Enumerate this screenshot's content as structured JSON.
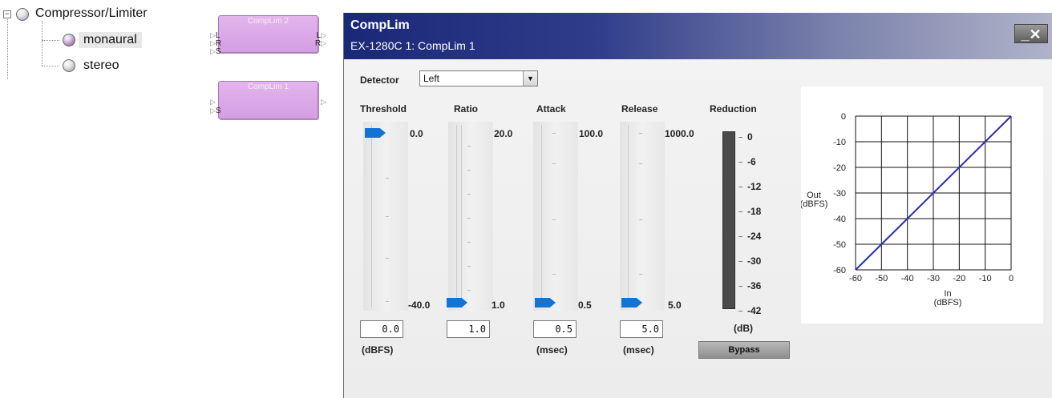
{
  "tree": {
    "root_label": "Compressor/Limiter",
    "expander": "−",
    "children": [
      "monaural",
      "stereo"
    ]
  },
  "blocks": [
    {
      "title": "CompLim 2",
      "inputs": [
        "L",
        "R",
        "S"
      ],
      "outputs": [
        "L",
        "R"
      ]
    },
    {
      "title": "CompLim 1",
      "inputs": [
        "",
        "S"
      ],
      "outputs": [
        ""
      ]
    }
  ],
  "dialog": {
    "title": "CompLim",
    "subtitle": "EX-1280C 1: CompLim 1",
    "close_label": "_✕",
    "detector": {
      "label": "Detector",
      "value": "Left"
    },
    "sliders": [
      {
        "label": "Threshold",
        "max": "0.0",
        "min": "-40.0",
        "value": "0.0",
        "unit": "(dBFS)",
        "level": 1.0
      },
      {
        "label": "Ratio",
        "max": "20.0",
        "min": "1.0",
        "value": "1.0",
        "unit": "",
        "level": 0.0
      },
      {
        "label": "Attack",
        "max": "100.0",
        "min": "0.5",
        "value": "0.5",
        "unit": "(msec)",
        "level": 0.0
      },
      {
        "label": "Release",
        "max": "1000.0",
        "min": "5.0",
        "value": "5.0",
        "unit": "(msec)",
        "level": 0.0
      }
    ],
    "reduction": {
      "label": "Reduction",
      "scale": [
        "0",
        "-6",
        "-12",
        "-18",
        "-24",
        "-30",
        "-36",
        "-42"
      ],
      "unit": "(dB)"
    },
    "bypass_label": "Bypass"
  },
  "chart_data": {
    "type": "line",
    "x": [
      -60,
      0
    ],
    "series": [
      {
        "values": [
          -60,
          0
        ]
      }
    ],
    "xlabel": "In\n(dBFS)",
    "ylabel": "Out\n(dBFS)",
    "xlim": [
      -60,
      0
    ],
    "ylim": [
      -60,
      0
    ],
    "xticks": [
      "-60",
      "-50",
      "-40",
      "-30",
      "-20",
      "-10",
      "0"
    ],
    "yticks": [
      "0",
      "-10",
      "-20",
      "-30",
      "-40",
      "-50",
      "-60"
    ],
    "grid": true,
    "line_color": "#2a2fa8"
  }
}
